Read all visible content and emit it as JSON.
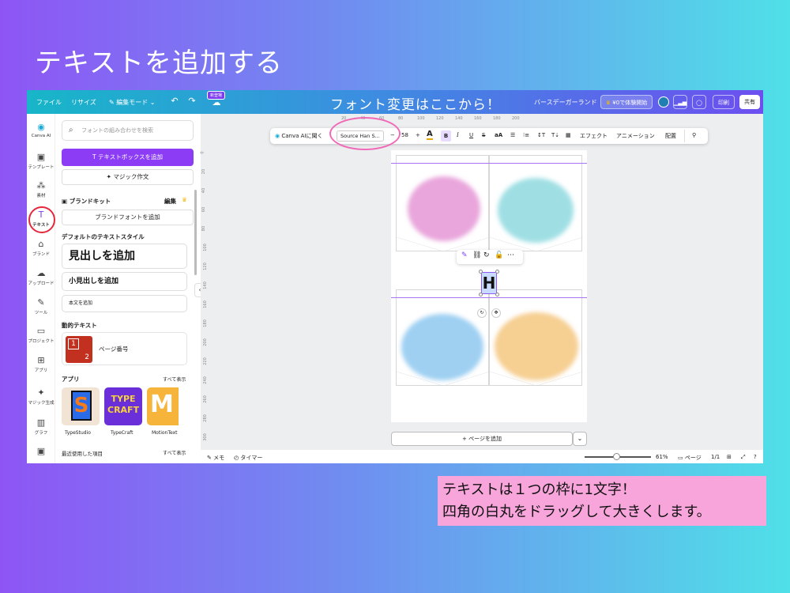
{
  "slide": {
    "title": "テキストを追加する",
    "note_line1": "テキストは１つの枠に1文字！",
    "note_line2": "四角の白丸をドラッグして大きくします。"
  },
  "topbar": {
    "file": "ファイル",
    "resize": "リサイズ",
    "edit_mode": "編集モード",
    "new_badge": "新登場",
    "annotation": "フォント変更はここから！",
    "doc_title": "バースデーガーランド",
    "trial": "¥0で体験開始",
    "print": "印刷",
    "share": "共有"
  },
  "rail": {
    "items": [
      {
        "label": "Canva AI",
        "icon": "◉"
      },
      {
        "label": "テンプレート",
        "icon": "▣"
      },
      {
        "label": "素材",
        "icon": "⁂"
      },
      {
        "label": "テキスト",
        "icon": "T"
      },
      {
        "label": "ブランド",
        "icon": "⌂"
      },
      {
        "label": "アップロード",
        "icon": "☁"
      },
      {
        "label": "ツール",
        "icon": "✎"
      },
      {
        "label": "プロジェクト",
        "icon": "▭"
      },
      {
        "label": "アプリ",
        "icon": "⊞"
      },
      {
        "label": "マジック生成",
        "icon": "✦"
      },
      {
        "label": "グラフ",
        "icon": "▥"
      },
      {
        "label": "",
        "icon": "▣"
      }
    ]
  },
  "panel": {
    "search_placeholder": "フォントの組み合わせを検索",
    "add_textbox": "テキストボックスを追加",
    "magic_write": "マジック作文",
    "brand_kit": "ブランドキット",
    "edit": "編集",
    "add_brand_fonts": "ブランドフォントを追加",
    "default_styles": "デフォルトのテキストスタイル",
    "heading": "見出しを追加",
    "subheading": "小見出しを追加",
    "body": "本文を追加",
    "dynamic_text": "動的テキスト",
    "page_number": "ページ番号",
    "page_number_thumb_1": "1",
    "page_number_thumb_2": "2",
    "apps": "アプリ",
    "see_all": "すべて表示",
    "app_names": [
      "TypeStudio",
      "TypeCraft",
      "MotionText"
    ],
    "app_tile_text": [
      "S",
      "TYPE CRAFT",
      "M"
    ],
    "recent": "最近使用した項目",
    "see_all_2": "すべて表示"
  },
  "toolbar": {
    "canva_ai": "Canva AIに聞く",
    "font_name": "Source Han S...",
    "minus": "−",
    "font_size": "58",
    "plus": "+",
    "effects": "エフェクト",
    "animation": "アニメーション",
    "arrange": "配置"
  },
  "ruler": {
    "h": [
      "20",
      "40",
      "60",
      "80",
      "100",
      "120",
      "140",
      "160",
      "180",
      "200"
    ],
    "v": [
      "0",
      "20",
      "40",
      "60",
      "80",
      "100",
      "120",
      "140",
      "160",
      "180",
      "200",
      "220",
      "240",
      "260",
      "280",
      "300"
    ]
  },
  "canvas": {
    "selected_letter": "H",
    "add_page": "+ ページを追加"
  },
  "statusbar": {
    "memo": "メモ",
    "timer": "タイマー",
    "zoom": "61%",
    "pages_label": "ページ",
    "page_count": "1/1"
  },
  "colors": {
    "accent": "#8b3cf4",
    "pink_blob": "#e9a6dc",
    "teal_blob": "#9fdfe4",
    "blue_blob": "#9fd0f2",
    "orange_blob": "#f6cf92"
  }
}
